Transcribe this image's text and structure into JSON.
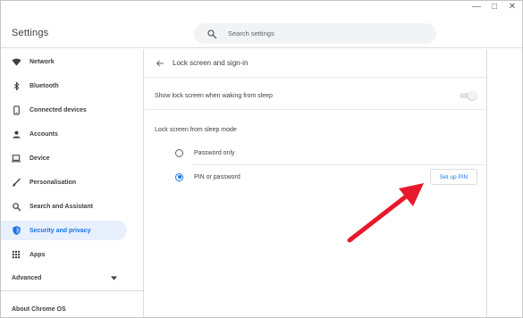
{
  "app": {
    "title": "Settings"
  },
  "search": {
    "placeholder": "Search settings"
  },
  "sidebar": {
    "items": [
      {
        "label": "Network",
        "icon": "wifi-icon"
      },
      {
        "label": "Bluetooth",
        "icon": "bluetooth-icon"
      },
      {
        "label": "Connected devices",
        "icon": "phone-icon"
      },
      {
        "label": "Accounts",
        "icon": "person-icon"
      },
      {
        "label": "Device",
        "icon": "laptop-icon"
      },
      {
        "label": "Personalisation",
        "icon": "brush-icon"
      },
      {
        "label": "Search and Assistant",
        "icon": "search-icon"
      },
      {
        "label": "Security and privacy",
        "icon": "shield-icon",
        "selected": true
      },
      {
        "label": "Apps",
        "icon": "apps-grid-icon"
      }
    ],
    "advanced_label": "Advanced",
    "about_label": "About Chrome OS"
  },
  "page": {
    "title": "Lock screen and sign-in",
    "show_lock_label": "Show lock screen when waking from sleep",
    "show_lock_enabled": false,
    "sleep_mode_heading": "Lock screen from sleep mode",
    "options": [
      {
        "label": "Password only",
        "selected": false
      },
      {
        "label": "PIN or password",
        "selected": true
      }
    ],
    "setup_pin_label": "Set up PIN"
  },
  "colors": {
    "accent": "#1a73e8",
    "selected_bg": "#e8f0fe",
    "annotation_arrow": "#e8192c"
  }
}
